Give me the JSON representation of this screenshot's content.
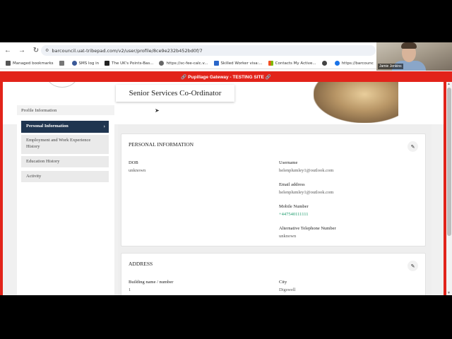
{
  "browser": {
    "url": "barcouncil.uat-tribepad.com/v2/user/profile/8ce9e232b452bd0f/7",
    "bookmarks": [
      {
        "label": "Managed bookmarks",
        "color": "#555555"
      },
      {
        "label": "",
        "color": "#777777"
      },
      {
        "label": "SMS log in",
        "color": "#3b5998"
      },
      {
        "label": "The UK's Points-Bas...",
        "color": "#222222"
      },
      {
        "label": "https://sc-fee-calc.v...",
        "color": "#666666"
      },
      {
        "label": "Skilled Worker visa:...",
        "color": "#2a66c9"
      },
      {
        "label": "Contacts My Active...",
        "color": "#d83b01"
      },
      {
        "label": "",
        "color": "#444444"
      },
      {
        "label": "https://barcounc",
        "color": "#1a73e8"
      }
    ]
  },
  "webcam": {
    "name": "Jamie Jenkins"
  },
  "banner": {
    "text": "🔗 Pupillage Gateway - TESTING SITE 🔗"
  },
  "header": {
    "job_title": "Senior Services Co-Ordinator"
  },
  "sidebar": {
    "section_title": "Profile Information",
    "items": [
      {
        "label": "Personal Information",
        "active": true
      },
      {
        "label": "Employment and Work Experience History",
        "active": false
      },
      {
        "label": "Education History",
        "active": false
      },
      {
        "label": "Activity",
        "active": false
      }
    ]
  },
  "personal": {
    "title": "PERSONAL INFORMATION",
    "dob_label": "DOB",
    "dob_value": "unknown",
    "username_label": "Username",
    "username_value": "helenplumley1@outlook.com",
    "email_label": "Email address",
    "email_value": "helenplumley1@outlook.com",
    "mobile_label": "Mobile Number",
    "mobile_value": "+447540111111",
    "alt_phone_label": "Alternative Telephone Number",
    "alt_phone_value": "unknown"
  },
  "address": {
    "title": "ADDRESS",
    "building_label": "Building name / number",
    "building_value": "1",
    "city_label": "City",
    "city_value": "Digswell"
  },
  "colors": {
    "banner": "#e2231a",
    "active_nav": "#1f3550",
    "link": "#1a9a6a"
  }
}
